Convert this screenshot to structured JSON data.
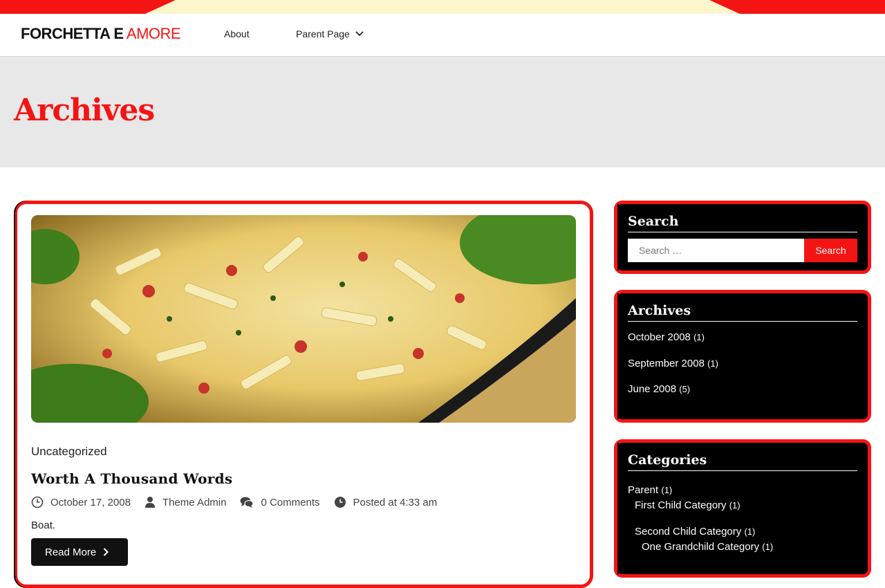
{
  "header": {
    "logo_bold": "FORCHETTA E",
    "logo_light": "AMORE",
    "nav": [
      {
        "label": "About"
      },
      {
        "label": "Parent Page",
        "icon": "chevron-down-icon"
      }
    ]
  },
  "page": {
    "title": "Archives"
  },
  "post": {
    "category": "Uncategorized",
    "title": "Worth A Thousand Words",
    "date": "October 17, 2008",
    "author": "Theme Admin",
    "comments": "0 Comments",
    "posted_at": "Posted at 4:33 am",
    "excerpt": "Boat.",
    "read_more": "Read More"
  },
  "sidebar": {
    "search": {
      "title": "Search",
      "placeholder": "Search …",
      "button": "Search"
    },
    "archives": {
      "title": "Archives",
      "items": [
        {
          "label": "October 2008",
          "count": "(1)"
        },
        {
          "label": "September 2008",
          "count": "(1)"
        },
        {
          "label": "June 2008",
          "count": "(5)"
        }
      ]
    },
    "categories": {
      "title": "Categories",
      "items": [
        {
          "label": "Parent",
          "count": "(1)"
        },
        {
          "label": "First Child Category",
          "count": "(1)"
        },
        {
          "label": "Second Child Category",
          "count": "(1)"
        },
        {
          "label": "One Grandchild Category",
          "count": "(1)"
        }
      ]
    }
  },
  "colors": {
    "accent": "#f51414",
    "band": "#e8e8e8",
    "widget_bg": "#000000",
    "strip_mid": "#fdf5cc"
  }
}
